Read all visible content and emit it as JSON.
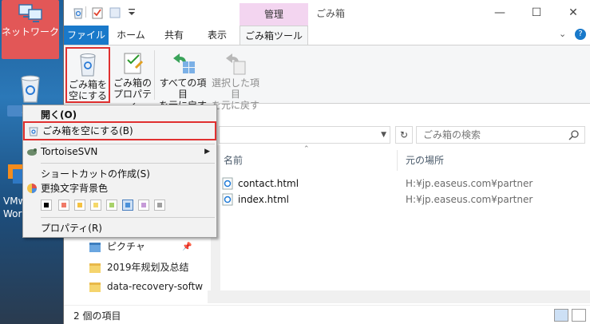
{
  "desktop": {
    "network_label": "ネットワーク",
    "trash_label": "ごみ",
    "vm_label": "VMw Work"
  },
  "window": {
    "manage_tab": "管理",
    "title": "ごみ箱",
    "minimize": "—",
    "maximize": "☐",
    "close": "✕"
  },
  "ribbon_tabs": {
    "file": "ファイル",
    "home": "ホーム",
    "share": "共有",
    "view": "表示",
    "recycle_tools": "ごみ箱ツール",
    "expand": "⌄",
    "help": "?"
  },
  "ribbon": {
    "empty_label_1": "ごみ箱を",
    "empty_label_2": "空にする",
    "props_label_1": "ごみ箱の",
    "props_label_2": "プロパティ",
    "restore_all_1": "すべての項目",
    "restore_all_2": "を元に戻す",
    "restore_sel_1": "選択した項目",
    "restore_sel_2": "を元に戻す"
  },
  "address": {
    "search_placeholder": "ごみ箱の検索",
    "refresh": "↻"
  },
  "columns": {
    "name": "名前",
    "location": "元の場所"
  },
  "files": [
    {
      "name": "contact.html",
      "location": "H:¥jp.easeus.com¥partner"
    },
    {
      "name": "index.html",
      "location": "H:¥jp.easeus.com¥partner"
    }
  ],
  "nav": {
    "pictures": "ピクチャ",
    "folder1": "2019年规划及总结",
    "folder2": "data-recovery-softw"
  },
  "status": {
    "count": "2 個の項目"
  },
  "context_menu": {
    "open": "開く(O)",
    "empty": "ごみ箱を空にする(B)",
    "svn": "TortoiseSVN",
    "shortcut": "ショートカットの作成(S)",
    "bgcolor": "更換文字背景色",
    "properties": "プロパティ(R)",
    "swatch_colors": [
      "#000000",
      "#f07a68",
      "#f5c242",
      "#f5d86a",
      "#a8d26a",
      "#4a90d9",
      "#c69ad8",
      "#a0a0a0"
    ]
  }
}
